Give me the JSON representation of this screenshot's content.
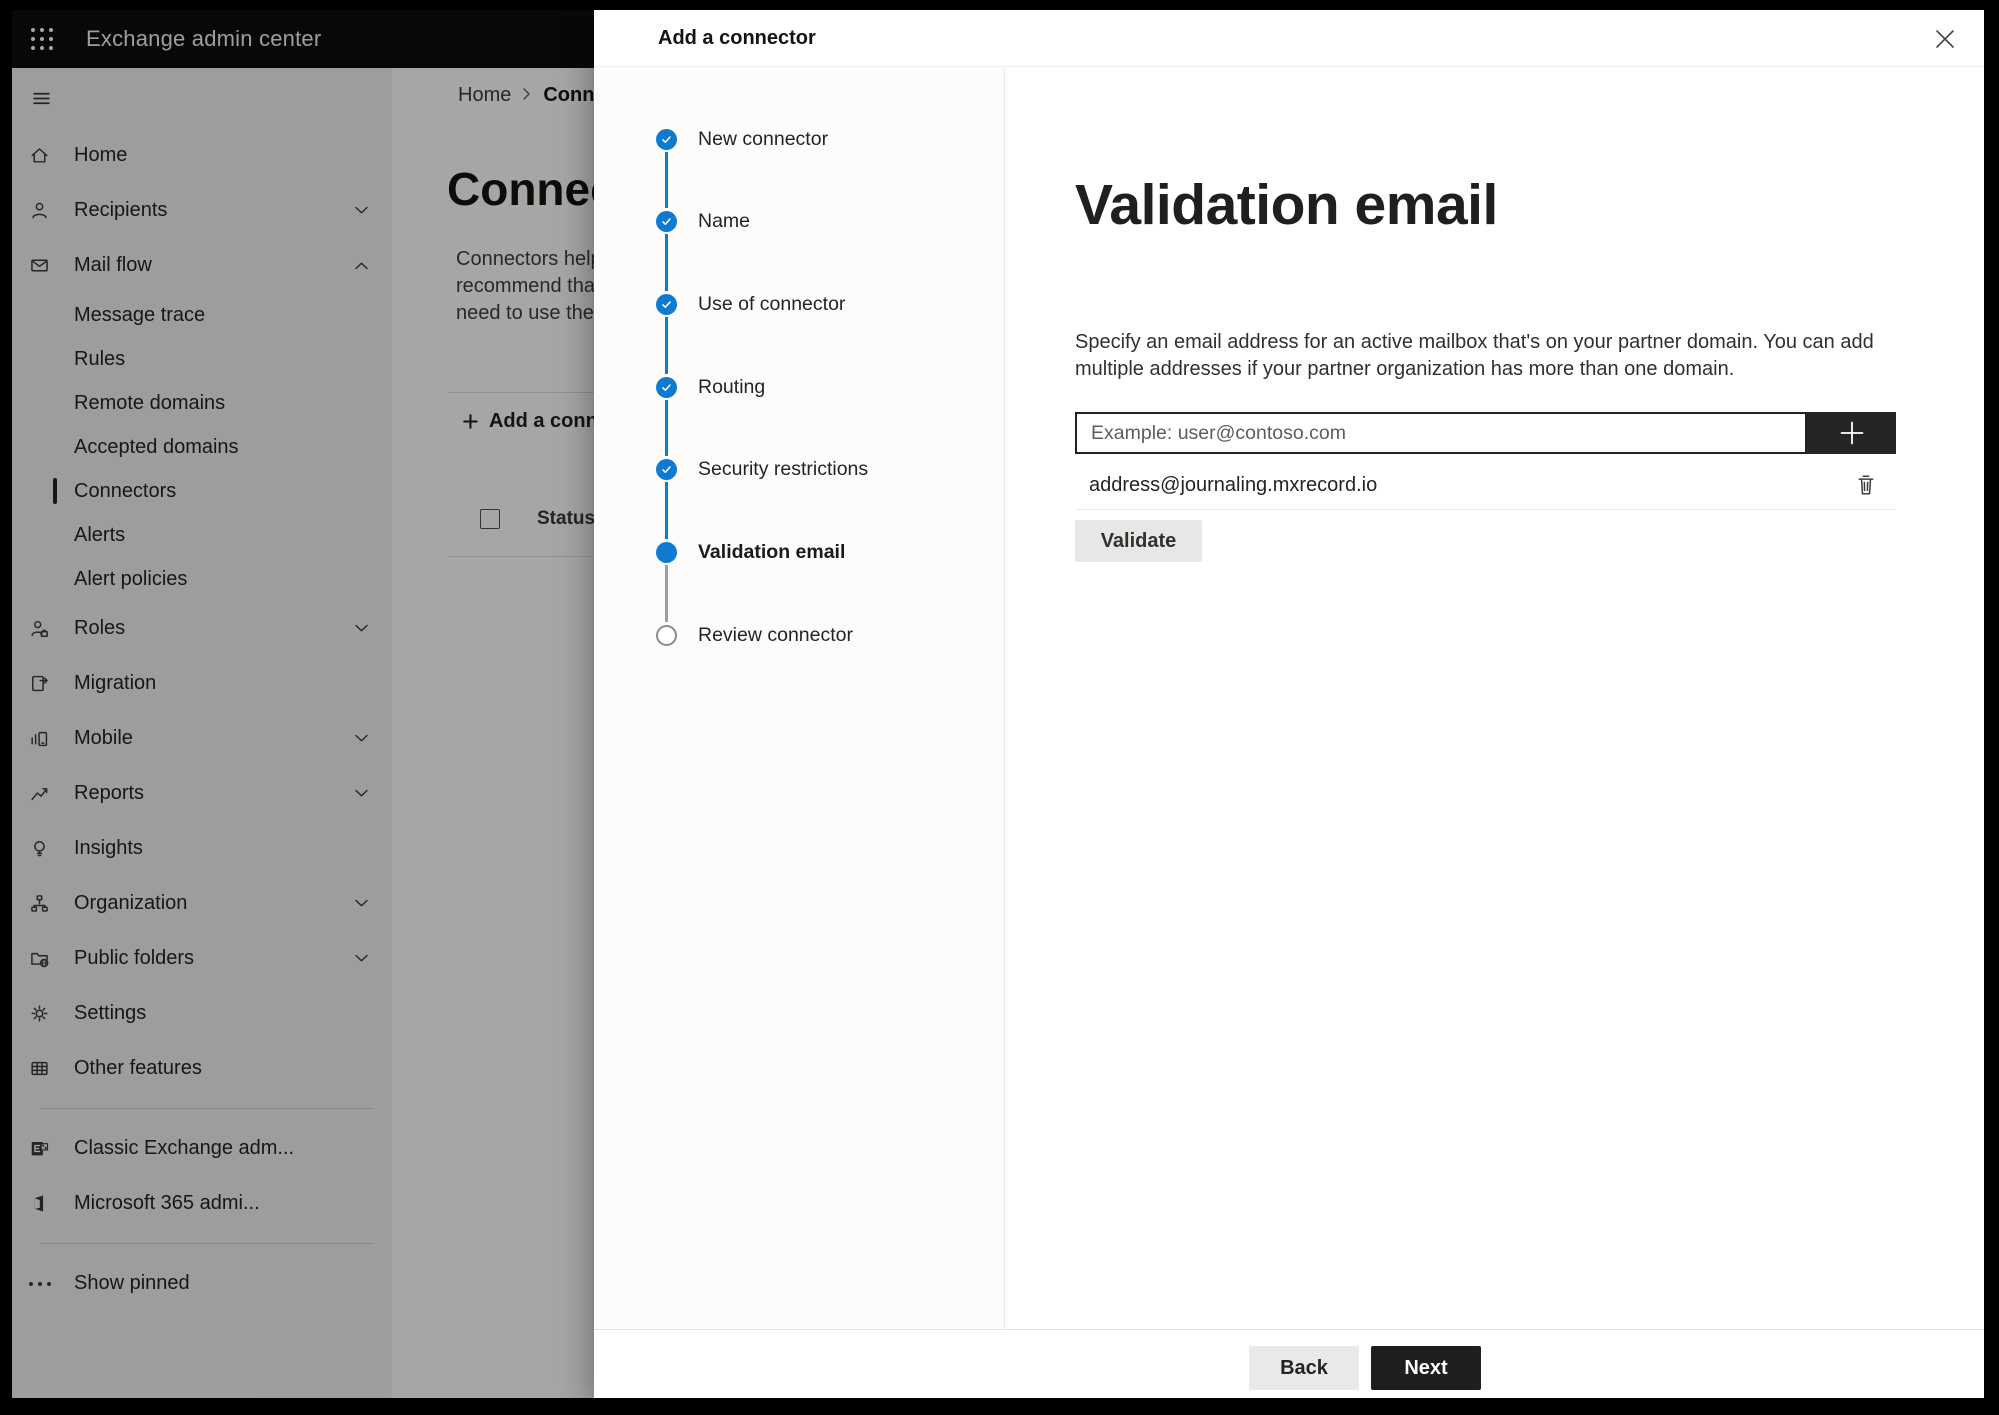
{
  "colors": {
    "accent_blue": "#0f7ad1",
    "topbar_bg": "#0d0d0d",
    "dark_button": "#262524",
    "overlay": "rgba(0,0,0,0.35)"
  },
  "icons": {
    "app_launcher": "waffle",
    "close": "✕",
    "breadcrumb_separator": "›",
    "step_check": "✓",
    "add_email": "+",
    "delete_address": "trash",
    "add_connector_plus": "+",
    "show_pinned_ellipsis": "..."
  },
  "topbar": {
    "title": "Exchange admin center"
  },
  "sidebar": {
    "items": [
      {
        "label": "Home"
      },
      {
        "label": "Recipients",
        "chevron": "down"
      },
      {
        "label": "Mail flow",
        "chevron": "up"
      },
      {
        "label": "Message trace",
        "sub": true
      },
      {
        "label": "Rules",
        "sub": true
      },
      {
        "label": "Remote domains",
        "sub": true
      },
      {
        "label": "Accepted domains",
        "sub": true
      },
      {
        "label": "Connectors",
        "sub": true,
        "selected": true
      },
      {
        "label": "Alerts",
        "sub": true
      },
      {
        "label": "Alert policies",
        "sub": true
      },
      {
        "label": "Roles",
        "chevron": "down"
      },
      {
        "label": "Migration"
      },
      {
        "label": "Mobile",
        "chevron": "down"
      },
      {
        "label": "Reports",
        "chevron": "down"
      },
      {
        "label": "Insights"
      },
      {
        "label": "Organization",
        "chevron": "down"
      },
      {
        "label": "Public folders",
        "chevron": "down"
      },
      {
        "label": "Settings"
      },
      {
        "label": "Other features"
      }
    ],
    "footer_items": [
      {
        "label": "Classic Exchange adm..."
      },
      {
        "label": "Microsoft 365 admi..."
      }
    ],
    "show_pinned_label": "Show pinned"
  },
  "page": {
    "breadcrumb": {
      "home": "Home",
      "current": "Conne"
    },
    "title": "Connec",
    "intro_lines": [
      "Connectors help",
      "recommend that",
      "need to use ther"
    ],
    "add_connector_label": "Add a conn",
    "status_column": "Status"
  },
  "dialog": {
    "title": "Add a connector",
    "steps": [
      {
        "label": "New connector",
        "state": "complete"
      },
      {
        "label": "Name",
        "state": "complete"
      },
      {
        "label": "Use of connector",
        "state": "complete"
      },
      {
        "label": "Routing",
        "state": "complete"
      },
      {
        "label": "Security restrictions",
        "state": "complete"
      },
      {
        "label": "Validation email",
        "state": "current"
      },
      {
        "label": "Review connector",
        "state": "upcoming"
      }
    ],
    "content": {
      "heading": "Validation email",
      "description": "Specify an email address for an active mailbox that's on your partner domain. You can add multiple addresses if your partner organization has more than one domain.",
      "email_placeholder": "Example: user@contoso.com",
      "addresses": [
        "address@journaling.mxrecord.io"
      ],
      "validate_label": "Validate"
    },
    "footer": {
      "back_label": "Back",
      "next_label": "Next"
    }
  }
}
